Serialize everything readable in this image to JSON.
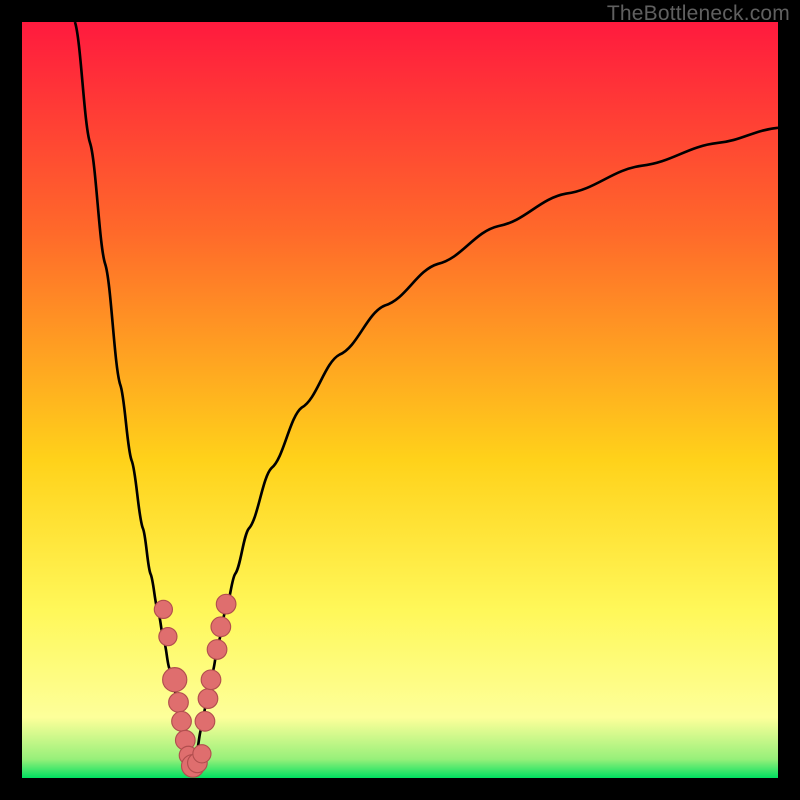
{
  "watermark": "TheBottleneck.com",
  "colors": {
    "top": "#ff1a3e",
    "mid_upper": "#ff6a2a",
    "mid": "#ffd21a",
    "mid_lower": "#fff85a",
    "green": "#00e060",
    "black": "#000000",
    "curve": "#000000",
    "dot_fill": "#df6e6e",
    "dot_stroke": "#b14e4e"
  },
  "chart_data": {
    "type": "line",
    "title": "",
    "xlabel": "",
    "ylabel": "",
    "xlim": [
      0,
      100
    ],
    "ylim": [
      0,
      100
    ],
    "series": [
      {
        "name": "left-branch",
        "x": [
          7,
          9,
          11,
          13,
          14.5,
          16,
          17,
          18,
          18.8,
          19.5,
          20.2,
          20.9,
          21.5,
          22.1,
          22.6
        ],
        "y": [
          100,
          84,
          68,
          52,
          42,
          33,
          27,
          22,
          18,
          14.5,
          11.5,
          8.5,
          6,
          3.5,
          1.6
        ]
      },
      {
        "name": "right-branch",
        "x": [
          22.6,
          23.1,
          23.7,
          24.4,
          25.2,
          26,
          27,
          28.2,
          30,
          33,
          37,
          42,
          48,
          55,
          63,
          72,
          82,
          92,
          100
        ],
        "y": [
          1.6,
          3.5,
          6.5,
          10,
          14,
          18,
          22.5,
          27,
          33,
          41,
          49,
          56,
          62.5,
          68,
          73,
          77.3,
          81,
          84,
          86
        ]
      }
    ],
    "dots": [
      {
        "x": 18.7,
        "y": 22.3,
        "r": 1.2
      },
      {
        "x": 19.3,
        "y": 18.7,
        "r": 1.2
      },
      {
        "x": 20.2,
        "y": 13.0,
        "r": 1.6
      },
      {
        "x": 20.7,
        "y": 10.0,
        "r": 1.3
      },
      {
        "x": 21.1,
        "y": 7.5,
        "r": 1.3
      },
      {
        "x": 21.6,
        "y": 5.0,
        "r": 1.3
      },
      {
        "x": 22.0,
        "y": 3.0,
        "r": 1.2
      },
      {
        "x": 22.6,
        "y": 1.6,
        "r": 1.5
      },
      {
        "x": 23.2,
        "y": 2.0,
        "r": 1.3
      },
      {
        "x": 23.8,
        "y": 3.2,
        "r": 1.2
      },
      {
        "x": 24.2,
        "y": 7.5,
        "r": 1.3
      },
      {
        "x": 24.6,
        "y": 10.5,
        "r": 1.3
      },
      {
        "x": 25.0,
        "y": 13.0,
        "r": 1.3
      },
      {
        "x": 25.8,
        "y": 17.0,
        "r": 1.3
      },
      {
        "x": 26.3,
        "y": 20.0,
        "r": 1.3
      },
      {
        "x": 27.0,
        "y": 23.0,
        "r": 1.3
      }
    ]
  }
}
